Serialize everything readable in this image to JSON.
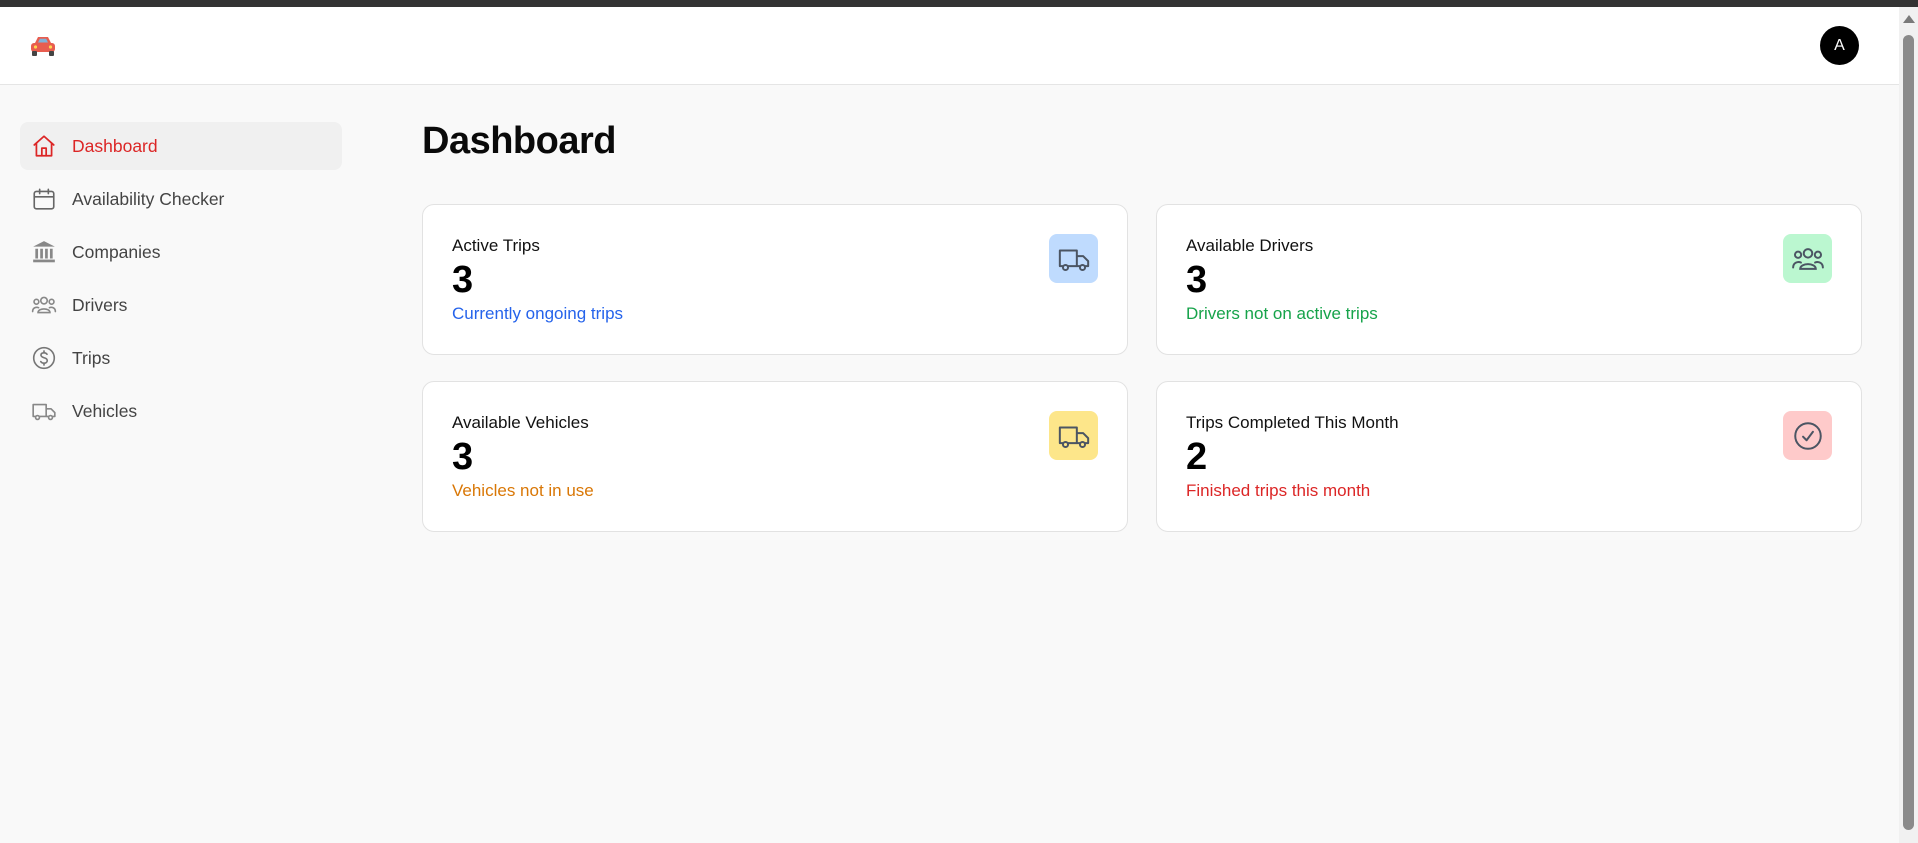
{
  "header": {
    "logo_icon": "car-icon",
    "avatar_initial": "A"
  },
  "sidebar": {
    "items": [
      {
        "label": "Dashboard",
        "icon": "home-icon",
        "active": true
      },
      {
        "label": "Availability Checker",
        "icon": "calendar-icon",
        "active": false
      },
      {
        "label": "Companies",
        "icon": "bank-icon",
        "active": false
      },
      {
        "label": "Drivers",
        "icon": "users-icon",
        "active": false
      },
      {
        "label": "Trips",
        "icon": "dollar-circle-icon",
        "active": false
      },
      {
        "label": "Vehicles",
        "icon": "truck-icon",
        "active": false
      }
    ]
  },
  "main": {
    "title": "Dashboard",
    "cards": [
      {
        "title": "Active Trips",
        "value": "3",
        "subtitle": "Currently ongoing trips",
        "icon": "truck-icon",
        "accent": "#2563eb",
        "icon_bg": "#bfdbfe"
      },
      {
        "title": "Available Drivers",
        "value": "3",
        "subtitle": "Drivers not on active trips",
        "icon": "users-icon",
        "accent": "#16a34a",
        "icon_bg": "#bbf7d0"
      },
      {
        "title": "Available Vehicles",
        "value": "3",
        "subtitle": "Vehicles not in use",
        "icon": "truck-icon",
        "accent": "#d97706",
        "icon_bg": "#fde68a"
      },
      {
        "title": "Trips Completed This Month",
        "value": "2",
        "subtitle": "Finished trips this month",
        "icon": "check-circle-icon",
        "accent": "#dc2626",
        "icon_bg": "#fecaca"
      }
    ]
  },
  "colors": {
    "brand": "#dc2626",
    "background": "#f9f9f9"
  }
}
